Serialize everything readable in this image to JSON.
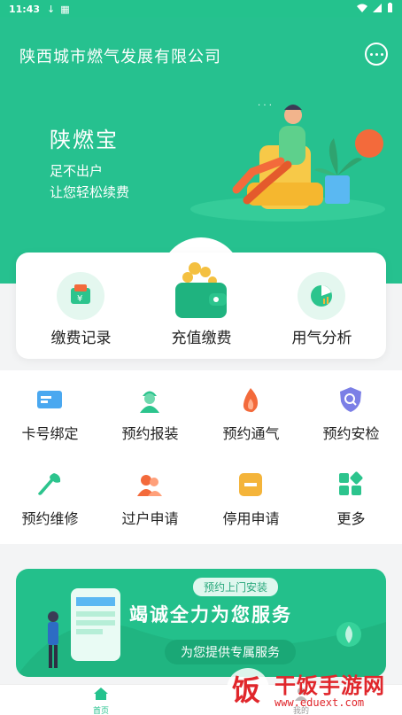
{
  "status_bar": {
    "time": "11:43"
  },
  "header": {
    "company_name": "陕西城市燃气发展有限公司"
  },
  "hero": {
    "brand": "陕燃宝",
    "line1": "足不出户",
    "line2": "让您轻松续费"
  },
  "quick_actions": [
    {
      "label": "缴费记录",
      "icon": "receipt-icon"
    },
    {
      "label": "充值缴费",
      "icon": "wallet-icon"
    },
    {
      "label": "用气分析",
      "icon": "pie-chart-icon"
    }
  ],
  "services": [
    {
      "label": "卡号绑定",
      "icon": "card-icon"
    },
    {
      "label": "预约报装",
      "icon": "worker-icon"
    },
    {
      "label": "预约通气",
      "icon": "flame-icon"
    },
    {
      "label": "预约安检",
      "icon": "shield-search-icon"
    },
    {
      "label": "预约维修",
      "icon": "wrench-icon"
    },
    {
      "label": "过户申请",
      "icon": "transfer-user-icon"
    },
    {
      "label": "停用申请",
      "icon": "stop-icon"
    },
    {
      "label": "更多",
      "icon": "more-grid-icon"
    }
  ],
  "banner": {
    "tag": "预约上门安装",
    "headline": "竭诚全力为您服务",
    "pill": "为您提供专属服务"
  },
  "tabbar": [
    {
      "label": "首页",
      "icon": "home-icon",
      "active": true
    },
    {
      "label": "我的",
      "icon": "user-icon",
      "active": false
    }
  ],
  "watermark": {
    "title": "干饭手游网",
    "url": "www.eduext.com",
    "logo_char": "饭"
  },
  "colors": {
    "brand_green": "#26c18f",
    "accent_orange": "#f36a3b",
    "accent_yellow": "#f4b43a",
    "accent_blue": "#4aa8f0"
  }
}
